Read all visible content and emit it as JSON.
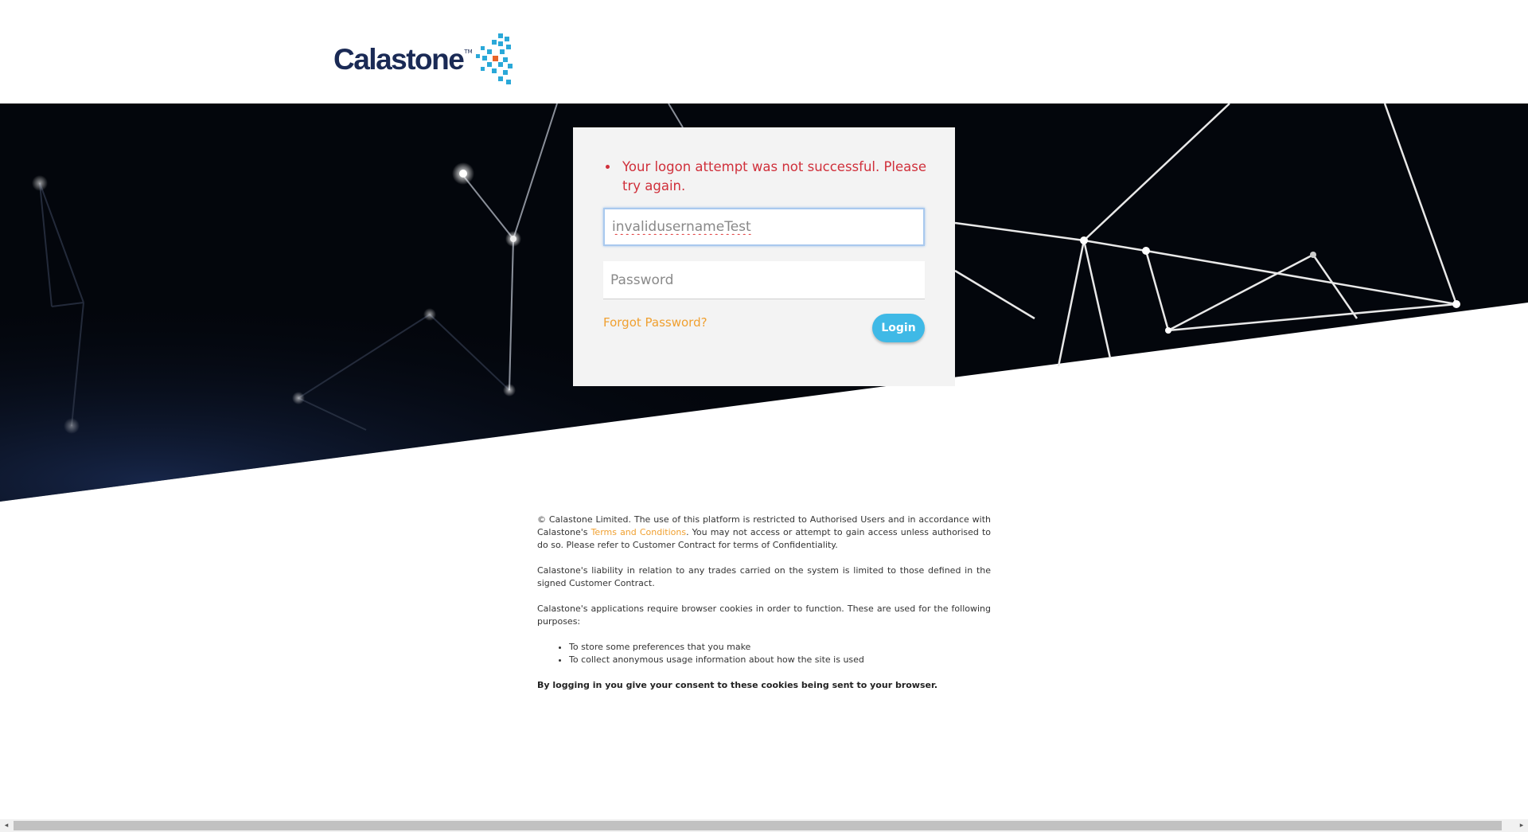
{
  "brand": {
    "name": "Calastone",
    "tm": "TM"
  },
  "login": {
    "errors": [
      "Your logon attempt was not successful. Please try again."
    ],
    "username_value": "invalidusernameTest",
    "password_placeholder": "Password",
    "forgot_label": "Forgot Password?",
    "login_label": "Login"
  },
  "legal": {
    "p1_pre": "© Calastone Limited. The use of this platform is restricted to Authorised Users and in accordance with Calastone's ",
    "p1_link": "Terms and Conditions",
    "p1_post": ". You may not access or attempt to gain access unless authorised to do so. Please refer to Customer Contract for terms of Confidentiality.",
    "p2": "Calastone's liability in relation to any trades carried on the system is limited to those defined in the signed Customer Contract.",
    "p3": "Calastone's applications require browser cookies in order to function. These are used for the following purposes:",
    "bullets": [
      "To store some preferences that you make",
      "To collect anonymous usage information about how the site is used"
    ],
    "consent": "By logging in you give your consent to these cookies being sent to your browser."
  },
  "colors": {
    "error": "#d0303b",
    "accent_link": "#f0a030",
    "login_button": "#3fb9e6",
    "brand_navy": "#1a2a55",
    "brand_cyan": "#2aa8d8"
  },
  "icons": {
    "logo_mark": "calastone-cube-mark",
    "scroll_left": "scroll-left-arrow-icon",
    "scroll_right": "scroll-right-arrow-icon"
  }
}
